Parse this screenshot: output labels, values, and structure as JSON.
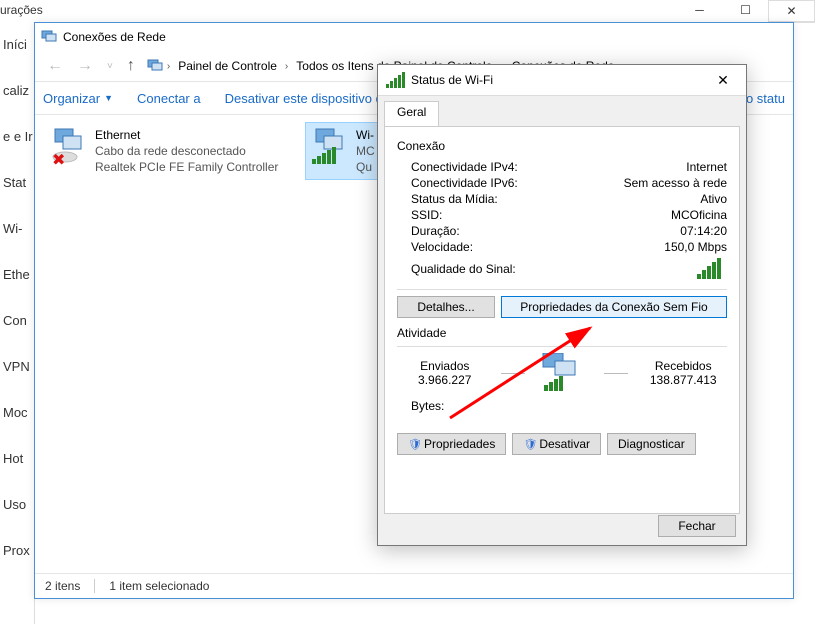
{
  "bg_window": {
    "title_fragment": "urações"
  },
  "sidebar_fragments": [
    "Iníci",
    "caliz",
    "e e Ir",
    "Stat",
    "Wi-",
    "Ethe",
    "Con",
    "VPN",
    "Moc",
    "Hot",
    "Uso",
    "Prox"
  ],
  "explorer": {
    "title": "Conexões de Rede",
    "breadcrumb": [
      "Painel de Controle",
      "Todos os Itens do Painel de Controle",
      "Conexões de Rede"
    ],
    "toolbar": {
      "organize": "Organizar",
      "connect": "Conectar a",
      "disable": "Desativar este dispositivo d",
      "right": "Exibir o statu"
    },
    "adapters": [
      {
        "name": "Ethernet",
        "line1": "Cabo da rede desconectado",
        "line2": "Realtek PCIe FE Family Controller"
      },
      {
        "name": "Wi-",
        "line1": "MC",
        "line2": "Qu"
      }
    ],
    "status": {
      "count": "2 itens",
      "selected": "1 item selecionado"
    }
  },
  "dialog": {
    "title": "Status de Wi-Fi",
    "tab": "Geral",
    "conn_header": "Conexão",
    "rows": {
      "ipv4_k": "Conectividade IPv4:",
      "ipv4_v": "Internet",
      "ipv6_k": "Conectividade IPv6:",
      "ipv6_v": "Sem acesso à rede",
      "media_k": "Status da Mídia:",
      "media_v": "Ativo",
      "ssid_k": "SSID:",
      "ssid_v": "MCOficina",
      "dur_k": "Duração:",
      "dur_v": "07:14:20",
      "spd_k": "Velocidade:",
      "spd_v": "150,0 Mbps",
      "sig_k": "Qualidade do Sinal:"
    },
    "btn_details": "Detalhes...",
    "btn_wireless_props": "Propriedades da Conexão Sem Fio",
    "activity_header": "Atividade",
    "sent_label": "Enviados",
    "recv_label": "Recebidos",
    "sent_val": "3.966.227",
    "recv_val": "138.877.413",
    "bytes_label": "Bytes:",
    "btn_props": "Propriedades",
    "btn_disable": "Desativar",
    "btn_diag": "Diagnosticar",
    "btn_close": "Fechar"
  }
}
